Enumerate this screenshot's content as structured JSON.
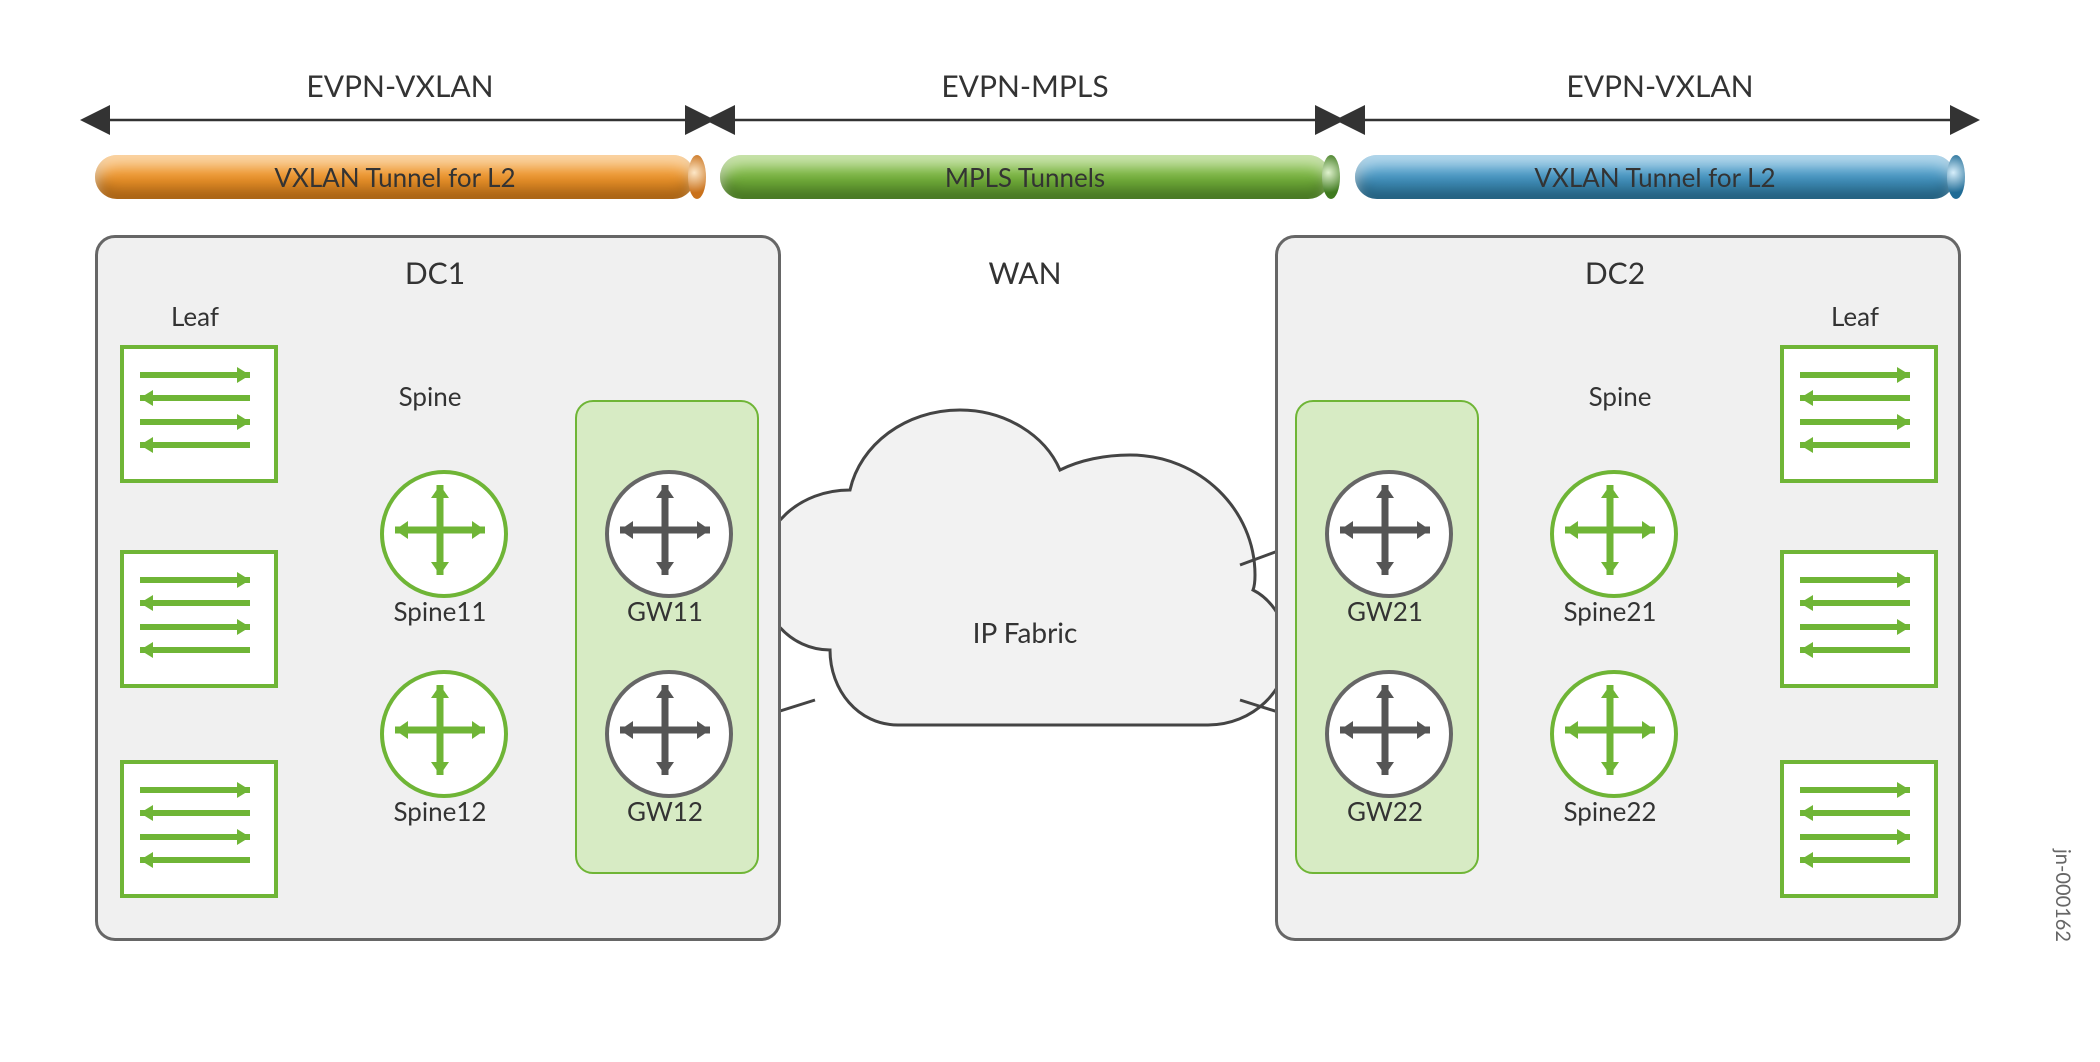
{
  "segments": {
    "left": {
      "header": "EVPN-VXLAN",
      "tube": "VXLAN Tunnel for L2"
    },
    "mid": {
      "header": "EVPN-MPLS",
      "tube": "MPLS Tunnels"
    },
    "right": {
      "header": "EVPN-VXLAN",
      "tube": "VXLAN Tunnel for L2"
    }
  },
  "dc1": {
    "title": "DC1",
    "leaf": "Leaf",
    "spine": "Spine",
    "spine1": "Spine11",
    "spine2": "Spine12",
    "gw1": "GW11",
    "gw2": "GW12"
  },
  "wan": {
    "title": "WAN",
    "cloud": "IP Fabric"
  },
  "dc2": {
    "title": "DC2",
    "leaf": "Leaf",
    "spine": "Spine",
    "spine1": "Spine21",
    "spine2": "Spine22",
    "gw1": "GW21",
    "gw2": "GW22"
  },
  "footer_id": "jn-000162"
}
